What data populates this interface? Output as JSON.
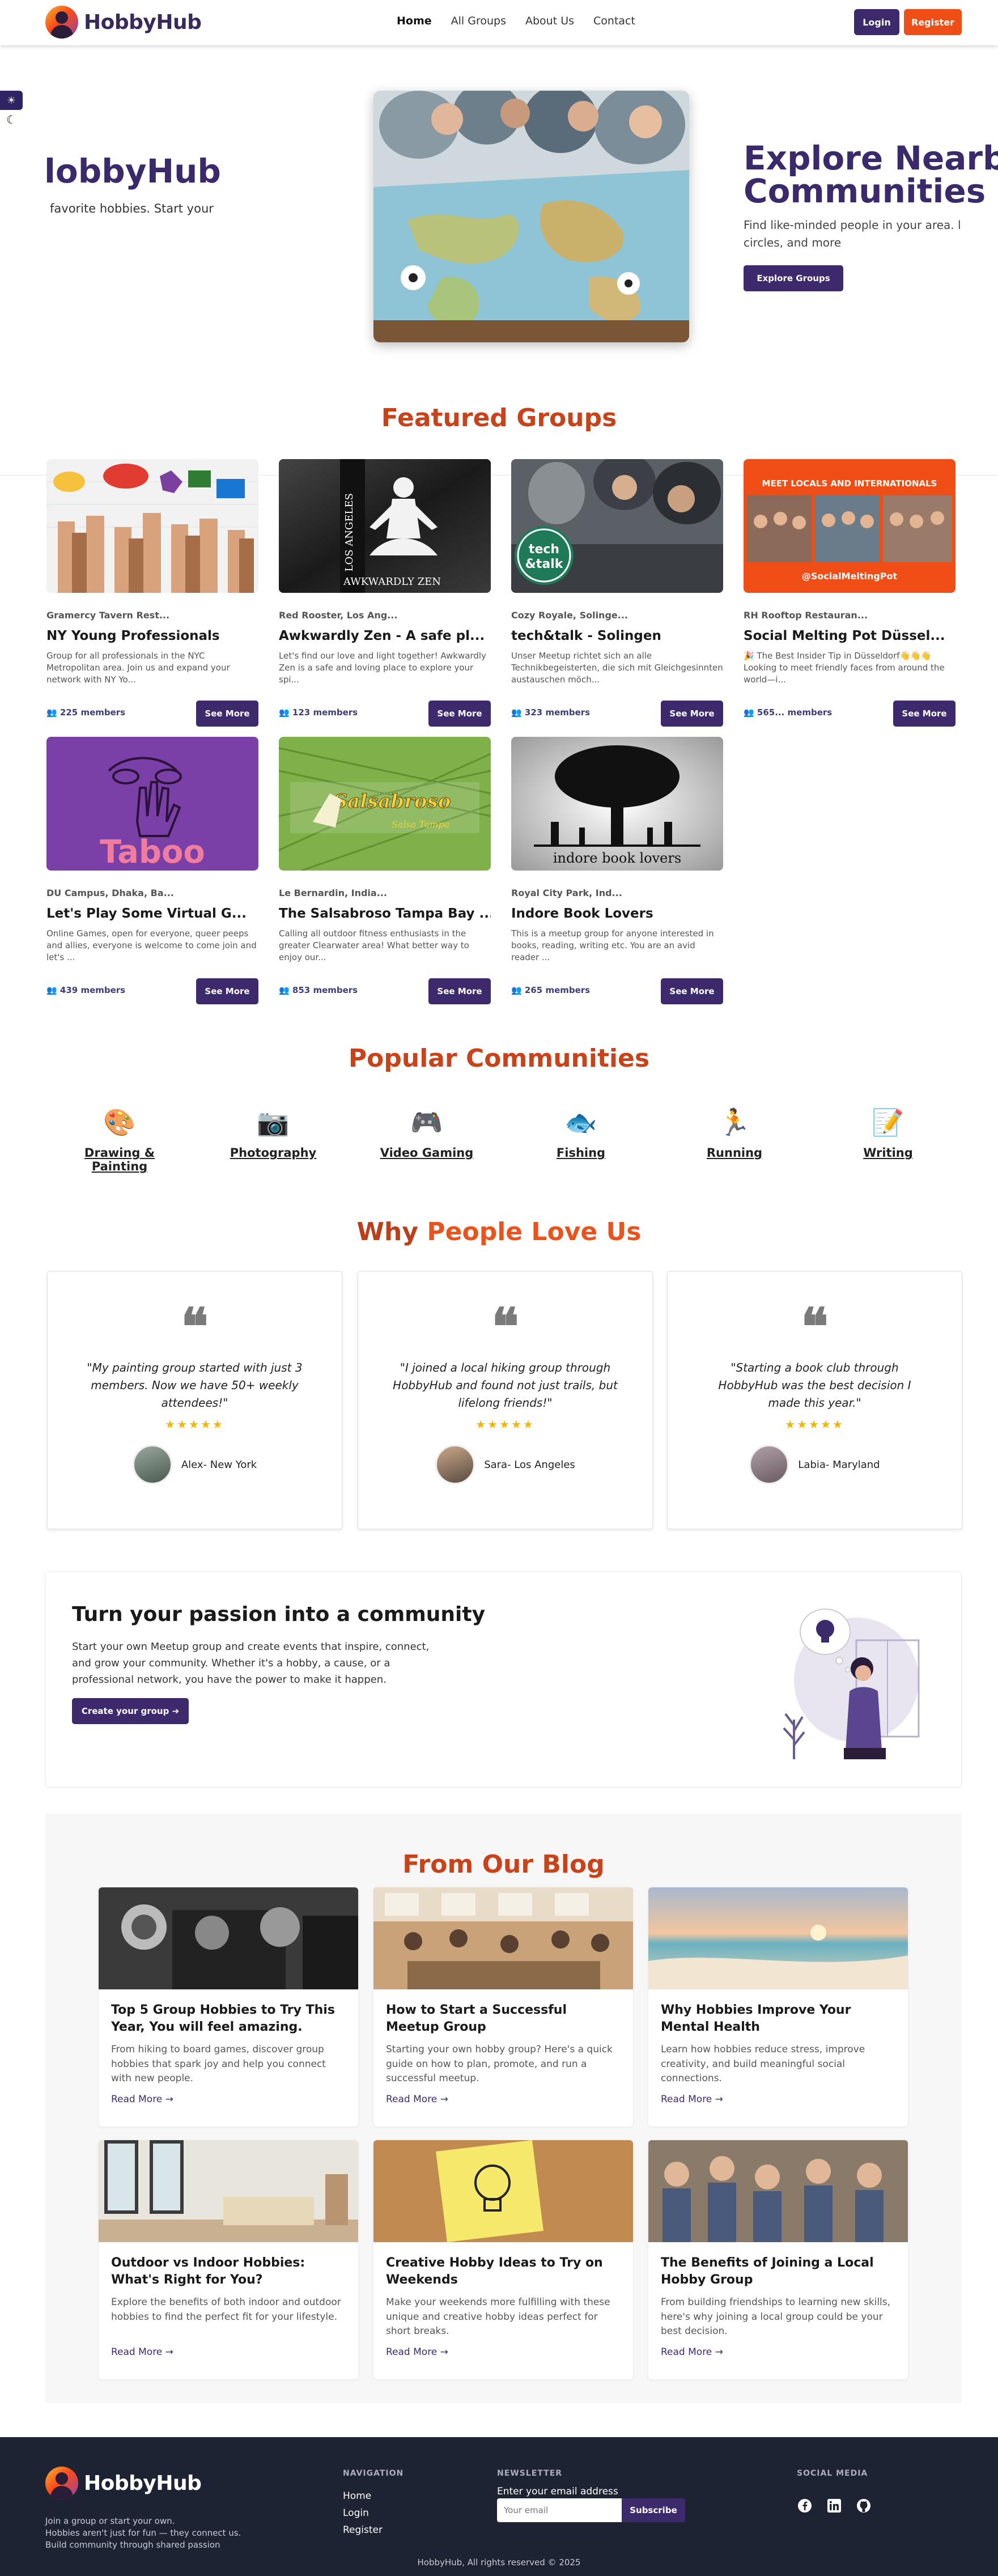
{
  "nav": {
    "brand": "HobbyHub",
    "links": [
      "Home",
      "All Groups",
      "About Us",
      "Contact"
    ],
    "login": "Login",
    "register": "Register"
  },
  "theme": {
    "sun": "☀",
    "moon": "☾"
  },
  "hero": {
    "left_title": "lobbyHub",
    "left_sub": "favorite hobbies. Start your",
    "right_title_1": "Explore Nearb",
    "right_title_2": "Communities",
    "right_desc": "Find like-minded people in your area. l circles, and more",
    "explore_button": "Explore Groups"
  },
  "featured": {
    "title": "Featured Groups",
    "members_suffix": "members",
    "see_more": "See More",
    "groups": [
      {
        "location": "Gramercy Tavern Rest...",
        "name": "NY Young Professionals",
        "desc": "Group for all professionals in the NYC Metropolitan area. Join us and expand your network with NY Yo...",
        "members": "225 members"
      },
      {
        "location": "Red Rooster, Los Ang...",
        "name": "Awkwardly Zen - A safe pl...",
        "desc": "Let's find our love and light together! Awkwardly Zen is a safe and loving place to explore your spi...",
        "members": "123 members",
        "img_text_1": "LOS ANGELES",
        "img_text_2": "AWKWARDLY ZEN"
      },
      {
        "location": "Cozy Royale, Solinge...",
        "name": "tech&talk - Solingen",
        "desc": "Unser Meetup richtet sich an alle Technikbegeisterten, die sich mit Gleichgesinnten austauschen möch...",
        "members": "323 members",
        "img_text_1": "tech",
        "img_text_2": "&talk"
      },
      {
        "location": "RH Rooftop Restauran...",
        "name": "Social Melting Pot Düssel...",
        "desc": "🎉 The Best Insider Tip in Düsseldorf👋👋👋 Looking to meet friendly faces from around the world—i...",
        "members": "565... members",
        "img_text_1": "MEET LOCALS AND INTERNATIONALS",
        "img_text_2": "@SocialMeltingPot"
      },
      {
        "location": "DU Campus, Dhaka, Ba...",
        "name": "Let's Play Some Virtual G...",
        "desc": "Online Games, open for everyone, queer peeps and allies, everyone is welcome to come join and let's ...",
        "members": "439 members",
        "img_text_1": "Taboo"
      },
      {
        "location": "Le Bernardin, India...",
        "name": "The Salsabroso Tampa Bay ...",
        "desc": "Calling all outdoor fitness enthusiasts in the greater Clearwater area! What better way to enjoy our...",
        "members": "853 members",
        "img_text_1": "Salsabroso",
        "img_text_2": "Salsa Tampa"
      },
      {
        "location": "Royal City Park, Ind...",
        "name": "Indore Book Lovers",
        "desc": "This is a meetup group for anyone interested in books, reading, writing etc. You are an avid reader ...",
        "members": "265 members",
        "img_text_1": "indore book lovers"
      }
    ]
  },
  "communities": {
    "title": "Popular Communities",
    "items": [
      {
        "label": "Drawing & Painting",
        "icon": "🎨"
      },
      {
        "label": "Photography",
        "icon": "📷"
      },
      {
        "label": "Video Gaming",
        "icon": "🎮"
      },
      {
        "label": "Fishing",
        "icon": "🐟"
      },
      {
        "label": "Running",
        "icon": "🏃"
      },
      {
        "label": "Writing",
        "icon": "📝"
      }
    ]
  },
  "testimonials": {
    "title_1": "Why ",
    "title_2": "People Love Us",
    "stars": "★★★★★",
    "quote_mark": "❝",
    "items": [
      {
        "quote": "\"My painting group started with just 3 members. Now we have 50+ weekly attendees!\"",
        "author": "Alex- New York"
      },
      {
        "quote": "\"I joined a local hiking group through HobbyHub and found not just trails, but lifelong friends!\"",
        "author": "Sara- Los Angeles"
      },
      {
        "quote": "\"Starting a book club through HobbyHub was the best decision I made this year.\"",
        "author": "Labia- Maryland"
      }
    ]
  },
  "cta": {
    "title": "Turn your passion into a community",
    "desc": "Start your own Meetup group and create events that inspire, connect, and grow your community. Whether it's a hobby, a cause, or a professional network, you have the power to make it happen.",
    "button": "Create your group ➔"
  },
  "blog": {
    "title": "From Our Blog",
    "read_more": "Read More →",
    "posts": [
      {
        "title": "Top 5 Group Hobbies to Try This Year, You will feel amazing.",
        "desc": "From hiking to board games, discover group hobbies that spark joy and help you connect with new people."
      },
      {
        "title": "How to Start a Successful Meetup Group",
        "desc": "Starting your own hobby group? Here's a quick guide on how to plan, promote, and run a successful meetup."
      },
      {
        "title": "Why Hobbies Improve Your Mental Health",
        "desc": "Learn how hobbies reduce stress, improve creativity, and build meaningful social connections."
      },
      {
        "title": "Outdoor vs Indoor Hobbies: What's Right for You?",
        "desc": "Explore the benefits of both indoor and outdoor hobbies to find the perfect fit for your lifestyle."
      },
      {
        "title": "Creative Hobby Ideas to Try on Weekends",
        "desc": "Make your weekends more fulfilling with these unique and creative hobby ideas perfect for short breaks."
      },
      {
        "title": "The Benefits of Joining a Local Hobby Group",
        "desc": "From building friendships to learning new skills, here's why joining a local group could be your best decision."
      }
    ]
  },
  "footer": {
    "brand": "HobbyHub",
    "tagline": [
      "Join a group or start your own.",
      "Hobbies aren't just for fun — they connect us.",
      "Build community through shared passion"
    ],
    "nav_head": "NAVIGATION",
    "nav_items": [
      "Home",
      "Login",
      "Register"
    ],
    "newsletter_head": "NEWSLETTER",
    "newsletter_label": "Enter your email address",
    "newsletter_placeholder": "Your email",
    "subscribe": "Subscribe",
    "social_head": "SOCIAL MEDIA",
    "copyright": "HobbyHub, All rights reserved © 2025"
  }
}
